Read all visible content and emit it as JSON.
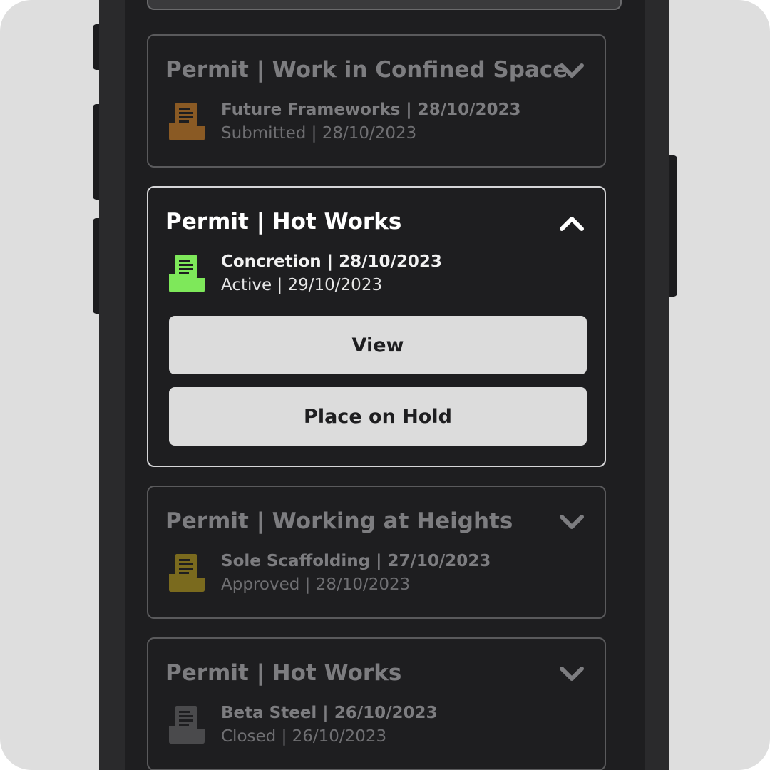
{
  "colors": {
    "background": "#dedede",
    "phone_body": "#2a2a2c",
    "screen": "#1e1e20",
    "card_border": "#5a5a5c",
    "card_border_active": "#d6d6d8",
    "button_bg": "#dcdcdc",
    "status_submitted": "#8a5a24",
    "status_active": "#7ee85a",
    "status_approved": "#7a6a1e",
    "status_closed": "#4a4a4c"
  },
  "permits": [
    {
      "title": "Permit | Work in Confined Space",
      "company_date": "Future Frameworks | 28/10/2023",
      "status_date": "Submitted | 28/10/2023",
      "icon": "folder-document-icon",
      "icon_color": "#8a5a24",
      "expanded": false
    },
    {
      "title": "Permit | Hot Works",
      "company_date": "Concretion | 28/10/2023",
      "status_date": "Active | 29/10/2023",
      "icon": "folder-document-icon",
      "icon_color": "#7ee85a",
      "expanded": true,
      "actions": {
        "view_label": "View",
        "hold_label": "Place on Hold"
      }
    },
    {
      "title": "Permit | Working at Heights",
      "company_date": "Sole Scaffolding | 27/10/2023",
      "status_date": "Approved | 28/10/2023",
      "icon": "folder-document-icon",
      "icon_color": "#7a6a1e",
      "expanded": false
    },
    {
      "title": "Permit | Hot Works",
      "company_date": "Beta Steel | 26/10/2023",
      "status_date": "Closed | 26/10/2023",
      "icon": "folder-document-icon",
      "icon_color": "#4a4a4c",
      "expanded": false
    }
  ]
}
